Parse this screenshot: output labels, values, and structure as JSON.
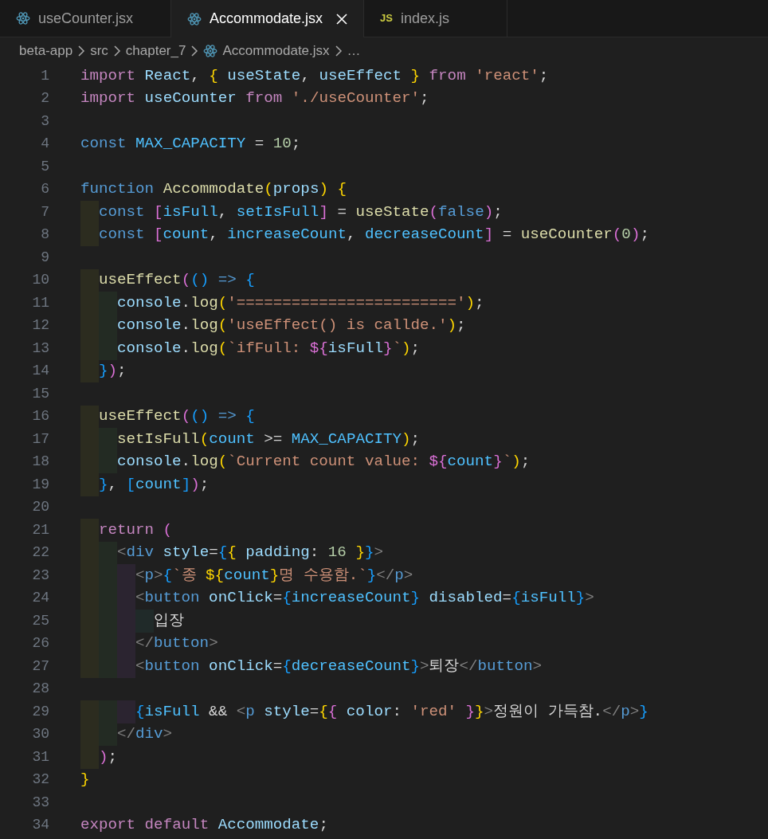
{
  "tabs": [
    {
      "label": "useCounter.jsx",
      "kind": "react",
      "selected": false
    },
    {
      "label": "Accommodate.jsx",
      "kind": "react",
      "selected": true
    },
    {
      "label": "index.js",
      "kind": "js",
      "icon_text": "JS",
      "selected": false
    }
  ],
  "breadcrumbs": [
    {
      "label": "beta-app",
      "kind": "folder"
    },
    {
      "label": "src",
      "kind": "folder"
    },
    {
      "label": "chapter_7",
      "kind": "folder"
    },
    {
      "label": "Accommodate.jsx",
      "kind": "react"
    },
    {
      "label": "…",
      "kind": "symbol"
    }
  ],
  "lines": [
    {
      "number": "1",
      "tokens": [
        {
          "kind": "keyword",
          "text": "import"
        },
        {
          "kind": "variable",
          "text": " React"
        },
        {
          "kind": "punct",
          "text": ", "
        },
        {
          "kind": "bracket1",
          "text": "{"
        },
        {
          "kind": "variable",
          "text": " useState"
        },
        {
          "kind": "punct",
          "text": ", "
        },
        {
          "kind": "variable",
          "text": "useEffect "
        },
        {
          "kind": "bracket1",
          "text": "}"
        },
        {
          "kind": "keyword",
          "text": " from "
        },
        {
          "kind": "string",
          "text": "'react'"
        },
        {
          "kind": "punct",
          "text": ";"
        }
      ]
    },
    {
      "number": "2",
      "tokens": [
        {
          "kind": "keyword",
          "text": "import"
        },
        {
          "kind": "variable",
          "text": " useCounter"
        },
        {
          "kind": "keyword",
          "text": " from "
        },
        {
          "kind": "string",
          "text": "'./useCounter'"
        },
        {
          "kind": "punct",
          "text": ";"
        }
      ]
    },
    {
      "number": "3"
    },
    {
      "number": "4",
      "tokens": [
        {
          "kind": "storage",
          "text": "const"
        },
        {
          "kind": "constant",
          "text": " MAX_CAPACITY"
        },
        {
          "kind": "punct",
          "text": " = "
        },
        {
          "kind": "number",
          "text": "10"
        },
        {
          "kind": "punct",
          "text": ";"
        }
      ]
    },
    {
      "number": "5"
    },
    {
      "number": "6",
      "tokens": [
        {
          "kind": "storage",
          "text": "function"
        },
        {
          "kind": "function",
          "text": " Accommodate"
        },
        {
          "kind": "bracket1",
          "text": "("
        },
        {
          "kind": "variable",
          "text": "props"
        },
        {
          "kind": "bracket1",
          "text": ")"
        },
        {
          "kind": "bracket1",
          "text": " {"
        }
      ]
    },
    {
      "number": "7",
      "tokens": [
        {
          "kind": "storage",
          "text": "  const"
        },
        {
          "kind": "bracket2",
          "text": " ["
        },
        {
          "kind": "constant",
          "text": "isFull"
        },
        {
          "kind": "punct",
          "text": ", "
        },
        {
          "kind": "constant",
          "text": "setIsFull"
        },
        {
          "kind": "bracket2",
          "text": "]"
        },
        {
          "kind": "punct",
          "text": " = "
        },
        {
          "kind": "function",
          "text": "useState"
        },
        {
          "kind": "bracket2",
          "text": "("
        },
        {
          "kind": "storage",
          "text": "false"
        },
        {
          "kind": "bracket2",
          "text": ")"
        },
        {
          "kind": "punct",
          "text": ";"
        }
      ]
    },
    {
      "number": "8",
      "tokens": [
        {
          "kind": "storage",
          "text": "  const"
        },
        {
          "kind": "bracket2",
          "text": " ["
        },
        {
          "kind": "constant",
          "text": "count"
        },
        {
          "kind": "punct",
          "text": ", "
        },
        {
          "kind": "constant",
          "text": "increaseCount"
        },
        {
          "kind": "punct",
          "text": ", "
        },
        {
          "kind": "constant",
          "text": "decreaseCount"
        },
        {
          "kind": "bracket2",
          "text": "]"
        },
        {
          "kind": "punct",
          "text": " = "
        },
        {
          "kind": "function",
          "text": "useCounter"
        },
        {
          "kind": "bracket2",
          "text": "("
        },
        {
          "kind": "number",
          "text": "0"
        },
        {
          "kind": "bracket2",
          "text": ")"
        },
        {
          "kind": "punct",
          "text": ";"
        }
      ]
    },
    {
      "number": "9"
    },
    {
      "number": "10",
      "tokens": [
        {
          "kind": "function",
          "text": "  useEffect"
        },
        {
          "kind": "bracket2",
          "text": "("
        },
        {
          "kind": "bracket3",
          "text": "()"
        },
        {
          "kind": "storage",
          "text": " => "
        },
        {
          "kind": "bracket3",
          "text": "{"
        }
      ]
    },
    {
      "number": "11",
      "tokens": [
        {
          "kind": "variable",
          "text": "    console"
        },
        {
          "kind": "punct",
          "text": "."
        },
        {
          "kind": "function",
          "text": "log"
        },
        {
          "kind": "bracket1",
          "text": "("
        },
        {
          "kind": "string",
          "text": "'========================'"
        },
        {
          "kind": "bracket1",
          "text": ")"
        },
        {
          "kind": "punct",
          "text": ";"
        }
      ]
    },
    {
      "number": "12",
      "tokens": [
        {
          "kind": "variable",
          "text": "    console"
        },
        {
          "kind": "punct",
          "text": "."
        },
        {
          "kind": "function",
          "text": "log"
        },
        {
          "kind": "bracket1",
          "text": "("
        },
        {
          "kind": "string",
          "text": "'useEffect() is callde.'"
        },
        {
          "kind": "bracket1",
          "text": ")"
        },
        {
          "kind": "punct",
          "text": ";"
        }
      ]
    },
    {
      "number": "13",
      "tokens": [
        {
          "kind": "variable",
          "text": "    console"
        },
        {
          "kind": "punct",
          "text": "."
        },
        {
          "kind": "function",
          "text": "log"
        },
        {
          "kind": "bracket1",
          "text": "("
        },
        {
          "kind": "string",
          "text": "`ifFull: "
        },
        {
          "kind": "bracket2",
          "text": "${"
        },
        {
          "kind": "variable",
          "text": "isFull"
        },
        {
          "kind": "bracket2",
          "text": "}"
        },
        {
          "kind": "string",
          "text": "`"
        },
        {
          "kind": "bracket1",
          "text": ")"
        },
        {
          "kind": "punct",
          "text": ";"
        }
      ]
    },
    {
      "number": "14",
      "tokens": [
        {
          "kind": "bracket3",
          "text": "  }"
        },
        {
          "kind": "bracket2",
          "text": ")"
        },
        {
          "kind": "punct",
          "text": ";"
        }
      ]
    },
    {
      "number": "15"
    },
    {
      "number": "16",
      "tokens": [
        {
          "kind": "function",
          "text": "  useEffect"
        },
        {
          "kind": "bracket2",
          "text": "("
        },
        {
          "kind": "bracket3",
          "text": "()"
        },
        {
          "kind": "storage",
          "text": " => "
        },
        {
          "kind": "bracket3",
          "text": "{"
        }
      ]
    },
    {
      "number": "17",
      "tokens": [
        {
          "kind": "function",
          "text": "    setIsFull"
        },
        {
          "kind": "bracket1",
          "text": "("
        },
        {
          "kind": "constant",
          "text": "count"
        },
        {
          "kind": "punct",
          "text": " >= "
        },
        {
          "kind": "constant",
          "text": "MAX_CAPACITY"
        },
        {
          "kind": "bracket1",
          "text": ")"
        },
        {
          "kind": "punct",
          "text": ";"
        }
      ]
    },
    {
      "number": "18",
      "tokens": [
        {
          "kind": "variable",
          "text": "    console"
        },
        {
          "kind": "punct",
          "text": "."
        },
        {
          "kind": "function",
          "text": "log"
        },
        {
          "kind": "bracket1",
          "text": "("
        },
        {
          "kind": "string",
          "text": "`Current count value: "
        },
        {
          "kind": "bracket2",
          "text": "${"
        },
        {
          "kind": "constant",
          "text": "count"
        },
        {
          "kind": "bracket2",
          "text": "}"
        },
        {
          "kind": "string",
          "text": "`"
        },
        {
          "kind": "bracket1",
          "text": ")"
        },
        {
          "kind": "punct",
          "text": ";"
        }
      ]
    },
    {
      "number": "19",
      "tokens": [
        {
          "kind": "bracket3",
          "text": "  }"
        },
        {
          "kind": "punct",
          "text": ","
        },
        {
          "kind": "bracket3",
          "text": " ["
        },
        {
          "kind": "constant",
          "text": "count"
        },
        {
          "kind": "bracket3",
          "text": "]"
        },
        {
          "kind": "bracket2",
          "text": ")"
        },
        {
          "kind": "punct",
          "text": ";"
        }
      ]
    },
    {
      "number": "20"
    },
    {
      "number": "21",
      "tokens": [
        {
          "kind": "keyword",
          "text": "  return"
        },
        {
          "kind": "bracket2",
          "text": " ("
        }
      ]
    },
    {
      "number": "22",
      "tokens": [
        {
          "kind": "angle",
          "text": "    <"
        },
        {
          "kind": "tag",
          "text": "div"
        },
        {
          "kind": "variable",
          "text": " style"
        },
        {
          "kind": "punct",
          "text": "="
        },
        {
          "kind": "bracket3",
          "text": "{"
        },
        {
          "kind": "bracket1",
          "text": "{"
        },
        {
          "kind": "variable",
          "text": " padding"
        },
        {
          "kind": "punct",
          "text": ": "
        },
        {
          "kind": "number",
          "text": "16"
        },
        {
          "kind": "bracket1",
          "text": " }"
        },
        {
          "kind": "bracket3",
          "text": "}"
        },
        {
          "kind": "angle",
          "text": ">"
        }
      ]
    },
    {
      "number": "23",
      "tokens": [
        {
          "kind": "angle",
          "text": "      <"
        },
        {
          "kind": "tag",
          "text": "p"
        },
        {
          "kind": "angle",
          "text": ">"
        },
        {
          "kind": "bracket3",
          "text": "{"
        },
        {
          "kind": "string",
          "text": "`종 "
        },
        {
          "kind": "bracket1",
          "text": "${"
        },
        {
          "kind": "constant",
          "text": "count"
        },
        {
          "kind": "bracket1",
          "text": "}"
        },
        {
          "kind": "string",
          "text": "명 수용함.`"
        },
        {
          "kind": "bracket3",
          "text": "}"
        },
        {
          "kind": "angle",
          "text": "</"
        },
        {
          "kind": "tag",
          "text": "p"
        },
        {
          "kind": "angle",
          "text": ">"
        }
      ]
    },
    {
      "number": "24",
      "tokens": [
        {
          "kind": "angle",
          "text": "      <"
        },
        {
          "kind": "tag",
          "text": "button"
        },
        {
          "kind": "variable",
          "text": " onClick"
        },
        {
          "kind": "punct",
          "text": "="
        },
        {
          "kind": "bracket3",
          "text": "{"
        },
        {
          "kind": "constant",
          "text": "increaseCount"
        },
        {
          "kind": "bracket3",
          "text": "}"
        },
        {
          "kind": "variable",
          "text": " disabled"
        },
        {
          "kind": "punct",
          "text": "="
        },
        {
          "kind": "bracket3",
          "text": "{"
        },
        {
          "kind": "constant",
          "text": "isFull"
        },
        {
          "kind": "bracket3",
          "text": "}"
        },
        {
          "kind": "angle",
          "text": ">"
        }
      ]
    },
    {
      "number": "25",
      "tokens": [
        {
          "kind": "text",
          "text": "        입장"
        }
      ]
    },
    {
      "number": "26",
      "tokens": [
        {
          "kind": "angle",
          "text": "      </"
        },
        {
          "kind": "tag",
          "text": "button"
        },
        {
          "kind": "angle",
          "text": ">"
        }
      ]
    },
    {
      "number": "27",
      "tokens": [
        {
          "kind": "angle",
          "text": "      <"
        },
        {
          "kind": "tag",
          "text": "button"
        },
        {
          "kind": "variable",
          "text": " onClick"
        },
        {
          "kind": "punct",
          "text": "="
        },
        {
          "kind": "bracket3",
          "text": "{"
        },
        {
          "kind": "constant",
          "text": "decreaseCount"
        },
        {
          "kind": "bracket3",
          "text": "}"
        },
        {
          "kind": "angle",
          "text": ">"
        },
        {
          "kind": "text",
          "text": "퇴장"
        },
        {
          "kind": "angle",
          "text": "</"
        },
        {
          "kind": "tag",
          "text": "button"
        },
        {
          "kind": "angle",
          "text": ">"
        }
      ]
    },
    {
      "number": "28"
    },
    {
      "number": "29",
      "tokens": [
        {
          "kind": "bracket3",
          "text": "      {"
        },
        {
          "kind": "constant",
          "text": "isFull"
        },
        {
          "kind": "punct",
          "text": " && "
        },
        {
          "kind": "angle",
          "text": "<"
        },
        {
          "kind": "tag",
          "text": "p"
        },
        {
          "kind": "variable",
          "text": " style"
        },
        {
          "kind": "punct",
          "text": "="
        },
        {
          "kind": "bracket1",
          "text": "{"
        },
        {
          "kind": "bracket2",
          "text": "{"
        },
        {
          "kind": "variable",
          "text": " color"
        },
        {
          "kind": "punct",
          "text": ": "
        },
        {
          "kind": "string",
          "text": "'red'"
        },
        {
          "kind": "bracket2",
          "text": " }"
        },
        {
          "kind": "bracket1",
          "text": "}"
        },
        {
          "kind": "angle",
          "text": ">"
        },
        {
          "kind": "text",
          "text": "정원이 가득참."
        },
        {
          "kind": "angle",
          "text": "</"
        },
        {
          "kind": "tag",
          "text": "p"
        },
        {
          "kind": "angle",
          "text": ">"
        },
        {
          "kind": "bracket3",
          "text": "}"
        }
      ]
    },
    {
      "number": "30",
      "tokens": [
        {
          "kind": "angle",
          "text": "    </"
        },
        {
          "kind": "tag",
          "text": "div"
        },
        {
          "kind": "angle",
          "text": ">"
        }
      ]
    },
    {
      "number": "31",
      "tokens": [
        {
          "kind": "bracket2",
          "text": "  )"
        },
        {
          "kind": "punct",
          "text": ";"
        }
      ]
    },
    {
      "number": "32",
      "tokens": [
        {
          "kind": "bracket1",
          "text": "}"
        }
      ]
    },
    {
      "number": "33"
    },
    {
      "number": "34",
      "tokens": [
        {
          "kind": "keyword",
          "text": "export default"
        },
        {
          "kind": "variable",
          "text": " Accommodate"
        },
        {
          "kind": "punct",
          "text": ";"
        }
      ]
    }
  ]
}
